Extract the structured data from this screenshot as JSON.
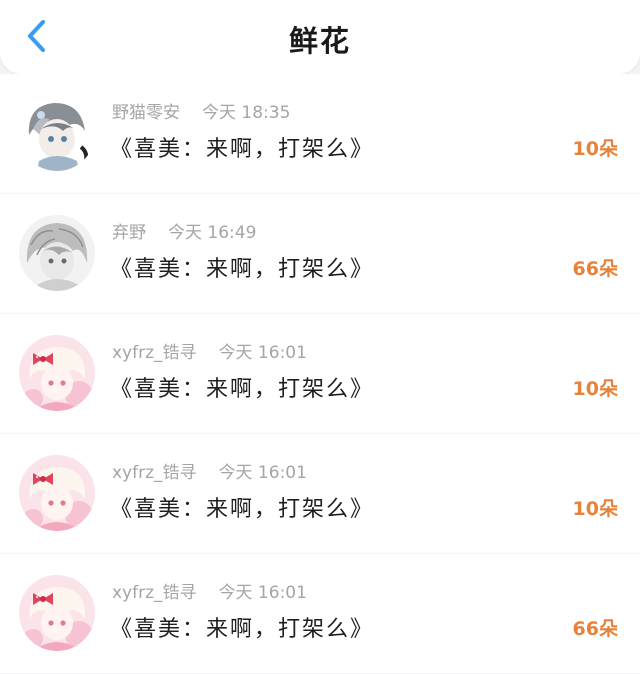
{
  "header": {
    "back_icon": "chevron-left-icon",
    "title": "鲜花"
  },
  "colors": {
    "accent_back": "#3a9bf0",
    "count_orange": "#e8823a",
    "meta_gray": "#a5a5a5"
  },
  "items": [
    {
      "username": "野猫零安",
      "time": "今天 18:35",
      "message": "《喜美：来啊，打架么》",
      "count": "10朵",
      "avatar": "anime-avatar-gray-hair-icon"
    },
    {
      "username": "弃野",
      "time": "今天 16:49",
      "message": "《喜美：来啊，打架么》",
      "count": "66朵",
      "avatar": "anime-avatar-sketch-icon"
    },
    {
      "username": "xyfrz_锆寻",
      "time": "今天 16:01",
      "message": "《喜美：来啊，打架么》",
      "count": "10朵",
      "avatar": "anime-avatar-pink-bow-icon"
    },
    {
      "username": "xyfrz_锆寻",
      "time": "今天 16:01",
      "message": "《喜美：来啊，打架么》",
      "count": "10朵",
      "avatar": "anime-avatar-pink-bow-icon"
    },
    {
      "username": "xyfrz_锆寻",
      "time": "今天 16:01",
      "message": "《喜美：来啊，打架么》",
      "count": "66朵",
      "avatar": "anime-avatar-pink-bow-icon"
    }
  ]
}
